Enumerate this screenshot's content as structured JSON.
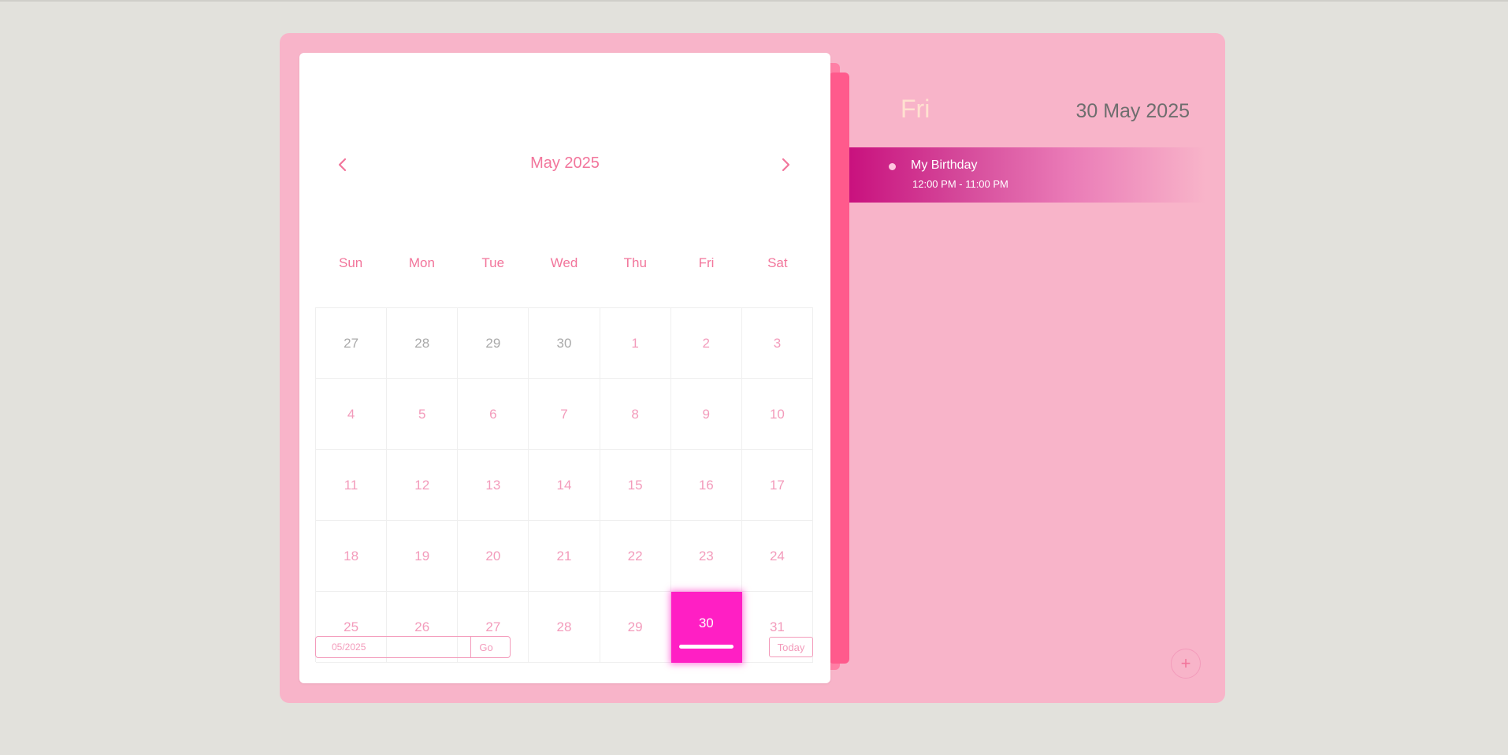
{
  "calendar": {
    "month_title": "May 2025",
    "weekdays": [
      "Sun",
      "Mon",
      "Tue",
      "Wed",
      "Thu",
      "Fri",
      "Sat"
    ],
    "weeks": [
      [
        "27",
        "28",
        "29",
        "30",
        "1",
        "2",
        "3"
      ],
      [
        "4",
        "5",
        "6",
        "7",
        "8",
        "9",
        "10"
      ],
      [
        "11",
        "12",
        "13",
        "14",
        "15",
        "16",
        "17"
      ],
      [
        "18",
        "19",
        "20",
        "21",
        "22",
        "23",
        "24"
      ],
      [
        "25",
        "26",
        "27",
        "28",
        "29",
        "30",
        "31"
      ]
    ],
    "selected_day": "30",
    "jump_input": {
      "value": "",
      "placeholder": "05/2025"
    },
    "go_label": "Go",
    "today_label": "Today"
  },
  "day_panel": {
    "day_name": "Fri",
    "full_date": "30 May 2025",
    "events": [
      {
        "title": "My Birthday",
        "time": "12:00 PM - 11:00 PM"
      }
    ],
    "add_label": "+"
  },
  "colors": {
    "background": "#e2e1dc",
    "panel": "#f8b4c9",
    "accent": "#f2759b",
    "selected": "#ff1fc4",
    "event_start": "#c9117e"
  },
  "icons": {
    "prev": "chevron-left-icon",
    "next": "chevron-right-icon",
    "add": "plus-icon"
  }
}
